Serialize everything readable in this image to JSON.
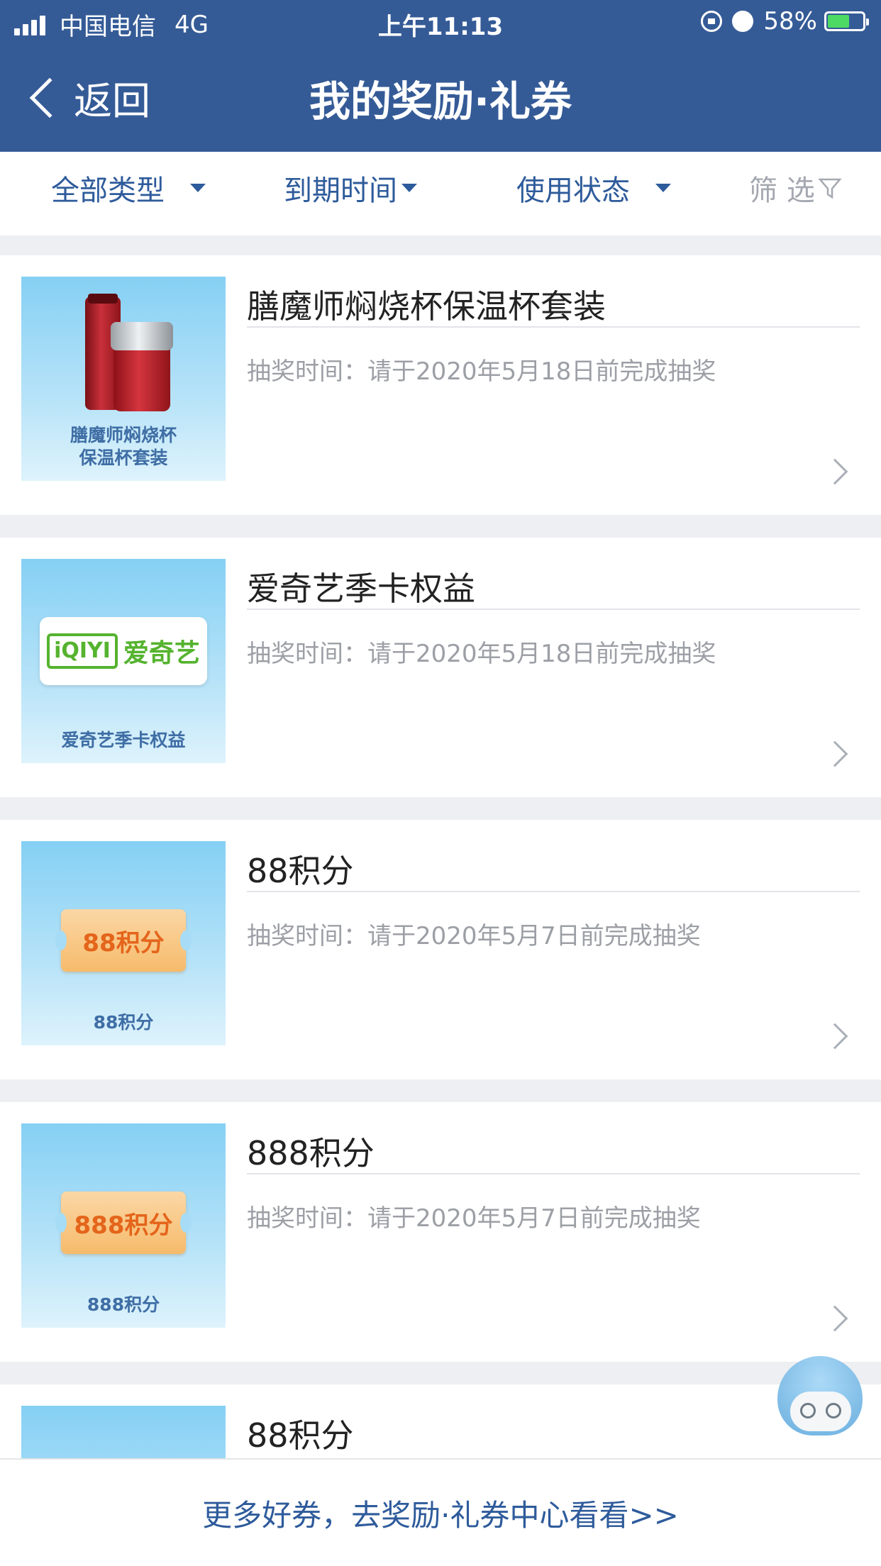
{
  "status_bar": {
    "carrier": "中国电信",
    "network": "4G",
    "time": "上午11:13",
    "battery": "58%",
    "battery_level": 0.58
  },
  "nav": {
    "back_label": "返回",
    "title": "我的奖励·礼券"
  },
  "filters": {
    "type": "全部类型",
    "expiry": "到期时间",
    "status": "使用状态",
    "screen": "筛 选"
  },
  "items": [
    {
      "title": "膳魔师焖烧杯保温杯套装",
      "meta": "抽奖时间：请于2020年5月18日前完成抽奖",
      "caption_line1": "膳魔师焖烧杯",
      "caption_line2": "保温杯套装"
    },
    {
      "title": "爱奇艺季卡权益",
      "meta": "抽奖时间：请于2020年5月18日前完成抽奖",
      "badge_mark": "iQIYI",
      "badge_name": "爱奇艺",
      "caption": "爱奇艺季卡权益"
    },
    {
      "title": "88积分",
      "meta": "抽奖时间：请于2020年5月7日前完成抽奖",
      "ticket": "88积分",
      "caption": "88积分"
    },
    {
      "title": "888积分",
      "meta": "抽奖时间：请于2020年5月7日前完成抽奖",
      "ticket": "888积分",
      "caption": "888积分"
    },
    {
      "title": "88积分"
    }
  ],
  "bottom_link": "更多好券，去奖励·礼券中心看看>>",
  "colors": {
    "header": "#355b97",
    "accent_text": "#2e5b9b"
  }
}
